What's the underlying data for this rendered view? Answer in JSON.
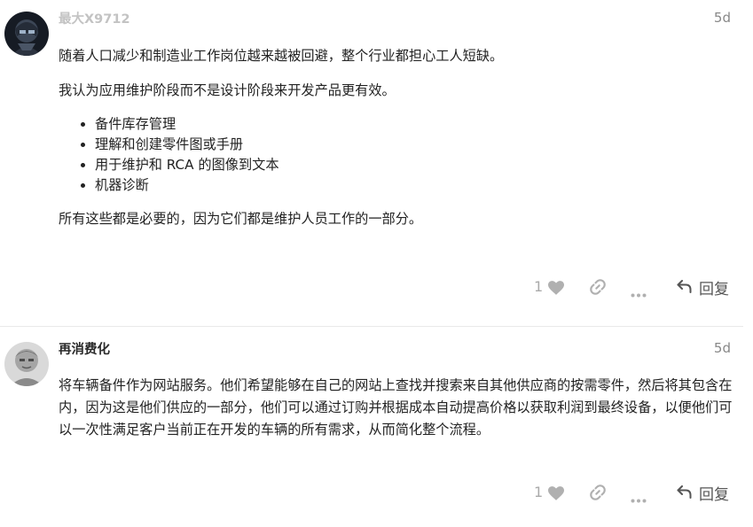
{
  "posts": [
    {
      "username": "最大X9712",
      "date": "5d",
      "paragraphs": [
        "随着人口减少和制造业工作岗位越来越被回避，整个行业都担心工人短缺。",
        "我认为应用维护阶段而不是设计阶段来开发产品更有效。"
      ],
      "bullets": [
        "备件库存管理",
        "理解和创建零件图或手册",
        "用于维护和 RCA 的图像到文本",
        "机器诊断"
      ],
      "closing": "所有这些都是必要的，因为它们都是维护人员工作的一部分。",
      "likes": "1",
      "reply_label": "回复"
    },
    {
      "username": "再消费化",
      "date": "5d",
      "paragraph": "将车辆备件作为网站服务。他们希望能够在自己的网站上查找并搜索来自其他供应商的按需零件，然后将其包含在内，因为这是他们供应的一部分，他们可以通过订购并根据成本自动提高价格以获取利润到最终设备，以便他们可以一次性满足客户当前正在开发的车辆的所有需求，从而简化整个流程。",
      "likes": "1",
      "reply_label": "回复"
    }
  ],
  "colors": {
    "icon_gray": "#b0b0b0",
    "text": "#222222",
    "meta": "#888888"
  },
  "icons": {
    "like": "heart-icon",
    "share": "link-icon",
    "more": "ellipsis-icon",
    "reply": "reply-arrow-icon"
  }
}
